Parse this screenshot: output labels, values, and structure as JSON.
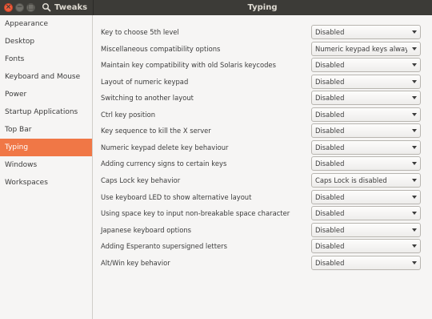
{
  "titlebar": {
    "app_title": "Tweaks",
    "page_title": "Typing",
    "close_glyph": "×",
    "minimize_glyph": "−",
    "maximize_glyph": "□"
  },
  "sidebar": {
    "items": [
      {
        "label": "Appearance",
        "active": false
      },
      {
        "label": "Desktop",
        "active": false
      },
      {
        "label": "Fonts",
        "active": false
      },
      {
        "label": "Keyboard and Mouse",
        "active": false
      },
      {
        "label": "Power",
        "active": false
      },
      {
        "label": "Startup Applications",
        "active": false
      },
      {
        "label": "Top Bar",
        "active": false
      },
      {
        "label": "Typing",
        "active": true
      },
      {
        "label": "Windows",
        "active": false
      },
      {
        "label": "Workspaces",
        "active": false
      }
    ]
  },
  "settings": [
    {
      "label": "Key to choose 5th level",
      "value": "Disabled"
    },
    {
      "label": "Miscellaneous compatibility options",
      "value": "Numeric keypad keys always ..."
    },
    {
      "label": "Maintain key compatibility with old Solaris keycodes",
      "value": "Disabled"
    },
    {
      "label": "Layout of numeric keypad",
      "value": "Disabled"
    },
    {
      "label": "Switching to another layout",
      "value": "Disabled"
    },
    {
      "label": "Ctrl key position",
      "value": "Disabled"
    },
    {
      "label": "Key sequence to kill the X server",
      "value": "Disabled"
    },
    {
      "label": "Numeric keypad delete key behaviour",
      "value": "Disabled"
    },
    {
      "label": "Adding currency signs to certain keys",
      "value": "Disabled"
    },
    {
      "label": "Caps Lock key behavior",
      "value": "Caps Lock is disabled"
    },
    {
      "label": "Use keyboard LED to show alternative layout",
      "value": "Disabled"
    },
    {
      "label": "Using space key to input non-breakable space character",
      "value": "Disabled"
    },
    {
      "label": "Japanese keyboard options",
      "value": "Disabled"
    },
    {
      "label": "Adding Esperanto supersigned letters",
      "value": "Disabled"
    },
    {
      "label": "Alt/Win key behavior",
      "value": "Disabled"
    }
  ],
  "colors": {
    "accent": "#f07746",
    "titlebar": "#3c3b37",
    "background": "#f6f5f4"
  },
  "icons": {
    "search": "search-icon",
    "dropdown": "chevron-down-icon"
  }
}
